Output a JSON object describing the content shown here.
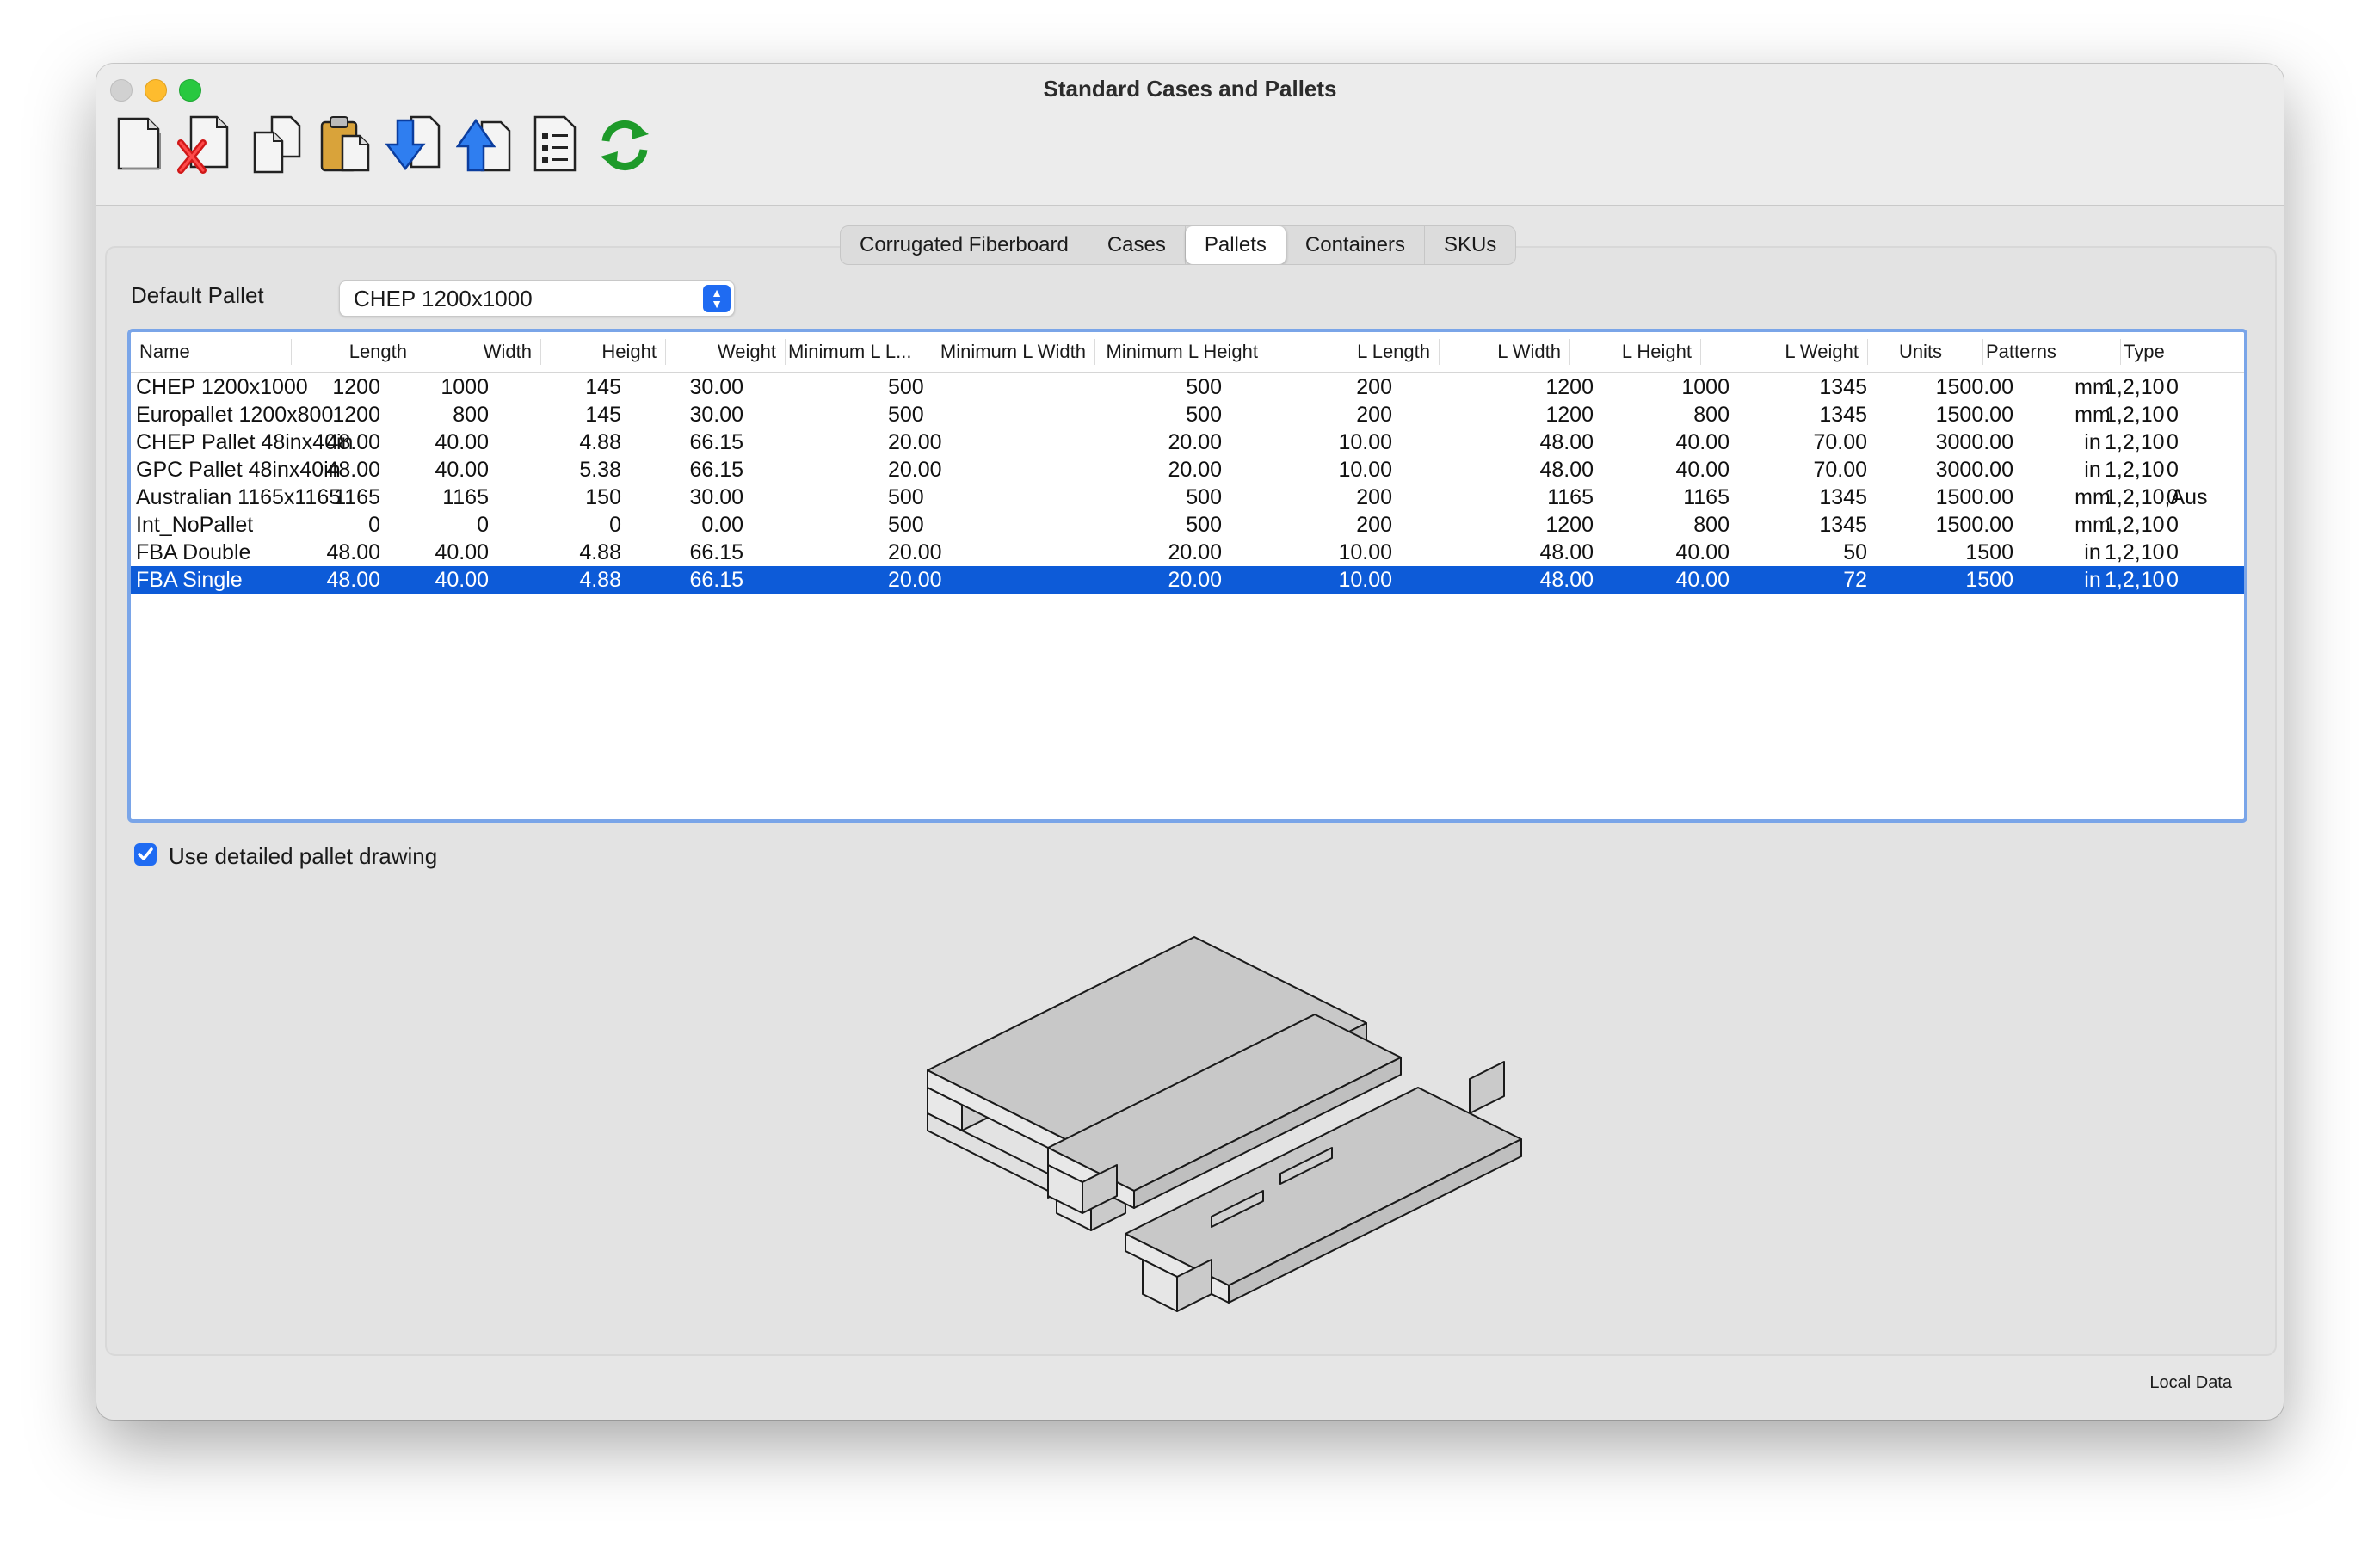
{
  "window": {
    "title": "Standard Cases and Pallets"
  },
  "toolbar": {
    "buttons": [
      {
        "icon": "new-document-icon"
      },
      {
        "icon": "delete-icon"
      },
      {
        "icon": "copy-icon"
      },
      {
        "icon": "paste-icon"
      },
      {
        "icon": "import-icon"
      },
      {
        "icon": "export-icon"
      },
      {
        "icon": "list-icon"
      },
      {
        "icon": "refresh-icon"
      }
    ]
  },
  "tabs": [
    {
      "label": "Corrugated Fiberboard",
      "active": false
    },
    {
      "label": "Cases",
      "active": false
    },
    {
      "label": "Pallets",
      "active": true
    },
    {
      "label": "Containers",
      "active": false
    },
    {
      "label": "SKUs",
      "active": false
    }
  ],
  "default_pallet": {
    "label": "Default Pallet",
    "value": "CHEP 1200x1000"
  },
  "table": {
    "columns": [
      "Name",
      "Length",
      "Width",
      "Height",
      "Weight",
      "Minimum L L...",
      "Minimum L Width",
      "Minimum L Height",
      "L Length",
      "L Width",
      "L Height",
      "L Weight",
      "Units",
      "Patterns",
      "Type"
    ],
    "rows": [
      [
        "CHEP 1200x1000",
        "1200",
        "1000",
        "145",
        "30.00",
        "500",
        "500",
        "200",
        "1200",
        "1000",
        "1345",
        "1500.00",
        "mm",
        "1,2,10",
        "0"
      ],
      [
        "Europallet 1200x800",
        "1200",
        "800",
        "145",
        "30.00",
        "500",
        "500",
        "200",
        "1200",
        "800",
        "1345",
        "1500.00",
        "mm",
        "1,2,10",
        "0"
      ],
      [
        "CHEP Pallet 48inx40in",
        "48.00",
        "40.00",
        "4.88",
        "66.15",
        "20.00",
        "20.00",
        "10.00",
        "48.00",
        "40.00",
        "70.00",
        "3000.00",
        "in",
        "1,2,10",
        "0"
      ],
      [
        "GPC Pallet 48inx40in",
        "48.00",
        "40.00",
        "5.38",
        "66.15",
        "20.00",
        "20.00",
        "10.00",
        "48.00",
        "40.00",
        "70.00",
        "3000.00",
        "in",
        "1,2,10",
        "0"
      ],
      [
        "Australian 1165x1165",
        "1165",
        "1165",
        "150",
        "30.00",
        "500",
        "500",
        "200",
        "1165",
        "1165",
        "1345",
        "1500.00",
        "mm",
        "1,2,10,Aus",
        "0"
      ],
      [
        "Int_NoPallet",
        "0",
        "0",
        "0",
        "0.00",
        "500",
        "500",
        "200",
        "1200",
        "800",
        "1345",
        "1500.00",
        "mm",
        "1,2,10",
        "0"
      ],
      [
        "FBA Double",
        "48.00",
        "40.00",
        "4.88",
        "66.15",
        "20.00",
        "20.00",
        "10.00",
        "48.00",
        "40.00",
        "50",
        "1500",
        "in",
        "1,2,10",
        "0"
      ],
      [
        "FBA Single",
        "48.00",
        "40.00",
        "4.88",
        "66.15",
        "20.00",
        "20.00",
        "10.00",
        "48.00",
        "40.00",
        "72",
        "1500",
        "in",
        "1,2,10",
        "0"
      ]
    ],
    "selected_row": 7
  },
  "detailed_drawing": {
    "label": "Use detailed pallet drawing",
    "checked": true
  },
  "status": {
    "text": "Local Data"
  },
  "colors": {
    "selection": "#0d5bd8",
    "focus_ring": "#7aa5e8",
    "accent": "#1f6bf2"
  }
}
